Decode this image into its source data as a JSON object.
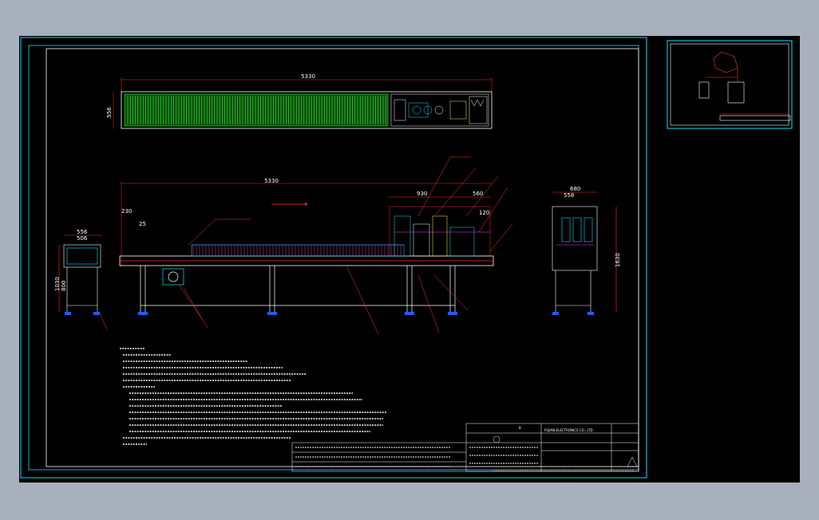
{
  "drawing": {
    "dims": {
      "top_length": "5330",
      "top_width": "556",
      "side_length": "5330",
      "side_230": "230",
      "side_25": "25",
      "side_930": "930",
      "side_560": "560",
      "side_120": "120",
      "side_1030": "1030",
      "side_800": "800",
      "left_556": "556",
      "left_506": "506",
      "right_680": "680",
      "right_558": "558",
      "right_1630": "1630"
    },
    "title_block": {
      "rev": "B",
      "company_line": "FUJIAN ELECTRONICS CO., LTD."
    }
  },
  "colors": {
    "frame": "#00e5ff",
    "border": "#ffffff",
    "dimension": "#ff2a2a",
    "belt": "#33ff33",
    "structure": "#ffffff",
    "leader": "#ff3333"
  }
}
